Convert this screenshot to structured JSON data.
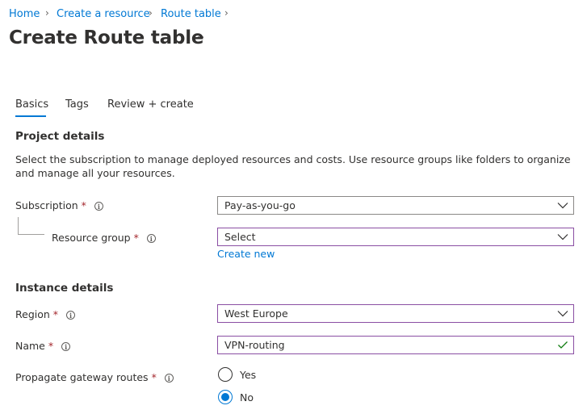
{
  "breadcrumb": {
    "items": [
      "Home",
      "Create a resource",
      "Route table"
    ]
  },
  "page": {
    "title": "Create Route table",
    "more": "···"
  },
  "tabs": [
    {
      "label": "Basics",
      "active": true
    },
    {
      "label": "Tags",
      "active": false
    },
    {
      "label": "Review + create",
      "active": false
    }
  ],
  "project": {
    "title": "Project details",
    "description": "Select the subscription to manage deployed resources and costs. Use resource groups like folders to organize and manage all your resources.",
    "subscription_label": "Subscription",
    "subscription_value": "Pay-as-you-go",
    "resource_group_label": "Resource group",
    "resource_group_value": "Select",
    "create_new": "Create new"
  },
  "instance": {
    "title": "Instance details",
    "region_label": "Region",
    "region_value": "West Europe",
    "name_label": "Name",
    "name_value": "VPN-routing",
    "propagate_label": "Propagate gateway routes",
    "options": [
      {
        "label": "Yes",
        "selected": false
      },
      {
        "label": "No",
        "selected": true
      }
    ]
  },
  "required_marker": "*",
  "icons": {
    "info": "info-icon",
    "dropdown": "chevron-down-icon",
    "valid": "checkmark-icon"
  },
  "colors": {
    "accent": "#0078d4",
    "required": "#a4262c",
    "valid": "#107c10",
    "focus_border": "#8a4ea3"
  }
}
